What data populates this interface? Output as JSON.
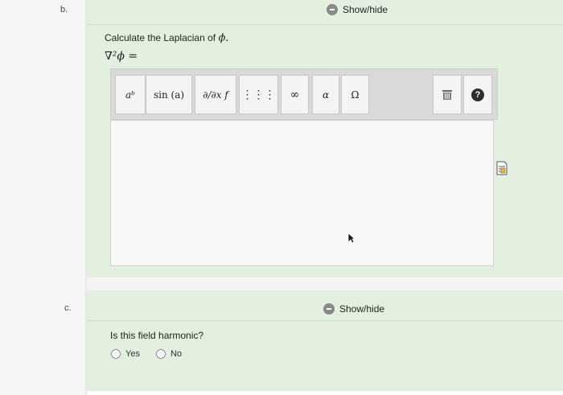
{
  "part_b": {
    "label": "b.",
    "show_hide": "Show/hide",
    "question": "Calculate the Laplacian of",
    "symbol_phi": "ϕ.",
    "answer_prefix": "∇²ϕ ="
  },
  "toolbar": {
    "power_label": "aᵇ",
    "sin_label": "sin (a)",
    "partial_label": "∂/∂x f",
    "matrix_label": "⋮⋮⋮",
    "infinity_label": "∞",
    "alpha_label": "α",
    "omega_label": "Ω",
    "trash_icon": "trash-icon",
    "help_label": "?"
  },
  "part_c": {
    "label": "c.",
    "show_hide": "Show/hide",
    "question": "Is this field harmonic?",
    "options": [
      "Yes",
      "No"
    ]
  },
  "colors": {
    "panel_bg": "#e4f0df",
    "help_bg": "#2e2e2e"
  }
}
